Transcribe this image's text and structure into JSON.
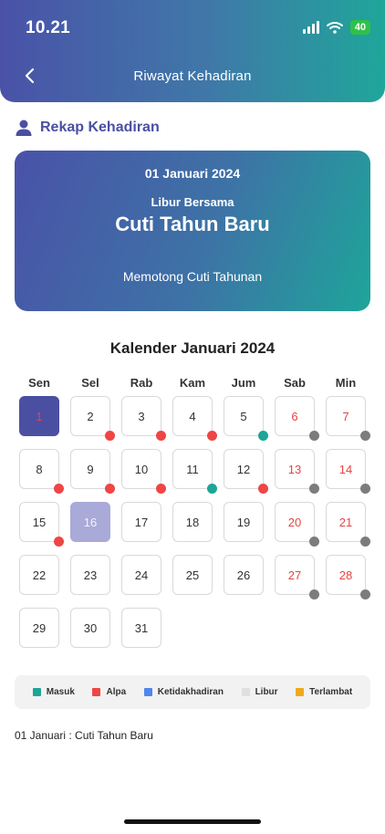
{
  "status_bar": {
    "time": "10.21",
    "battery": "40"
  },
  "header": {
    "title": "Riwayat Kehadiran"
  },
  "section": {
    "title": "Rekap Kehadiran"
  },
  "card": {
    "date": "01 Januari 2024",
    "type": "Libur Bersama",
    "name": "Cuti Tahun Baru",
    "note": "Memotong Cuti Tahunan"
  },
  "calendar": {
    "title": "Kalender Januari 2024",
    "weekdays": [
      "Sen",
      "Sel",
      "Rab",
      "Kam",
      "Jum",
      "Sab",
      "Min"
    ],
    "days": [
      {
        "day": "1",
        "style": "holiday",
        "status": ""
      },
      {
        "day": "2",
        "style": "",
        "status": "alpa"
      },
      {
        "day": "3",
        "style": "",
        "status": "alpa"
      },
      {
        "day": "4",
        "style": "",
        "status": "alpa"
      },
      {
        "day": "5",
        "style": "",
        "status": "masuk"
      },
      {
        "day": "6",
        "style": "weekend",
        "status": "libur"
      },
      {
        "day": "7",
        "style": "weekend",
        "status": "libur"
      },
      {
        "day": "8",
        "style": "",
        "status": "alpa"
      },
      {
        "day": "9",
        "style": "",
        "status": "alpa"
      },
      {
        "day": "10",
        "style": "",
        "status": "alpa"
      },
      {
        "day": "11",
        "style": "",
        "status": "masuk"
      },
      {
        "day": "12",
        "style": "",
        "status": "alpa"
      },
      {
        "day": "13",
        "style": "weekend",
        "status": "libur"
      },
      {
        "day": "14",
        "style": "weekend",
        "status": "libur"
      },
      {
        "day": "15",
        "style": "",
        "status": "alpa"
      },
      {
        "day": "16",
        "style": "today",
        "status": ""
      },
      {
        "day": "17",
        "style": "",
        "status": ""
      },
      {
        "day": "18",
        "style": "",
        "status": ""
      },
      {
        "day": "19",
        "style": "",
        "status": ""
      },
      {
        "day": "20",
        "style": "weekend",
        "status": "libur"
      },
      {
        "day": "21",
        "style": "weekend",
        "status": "libur"
      },
      {
        "day": "22",
        "style": "",
        "status": ""
      },
      {
        "day": "23",
        "style": "",
        "status": ""
      },
      {
        "day": "24",
        "style": "",
        "status": ""
      },
      {
        "day": "25",
        "style": "",
        "status": ""
      },
      {
        "day": "26",
        "style": "",
        "status": ""
      },
      {
        "day": "27",
        "style": "weekend",
        "status": "libur"
      },
      {
        "day": "28",
        "style": "weekend",
        "status": "libur"
      },
      {
        "day": "29",
        "style": "",
        "status": ""
      },
      {
        "day": "30",
        "style": "",
        "status": ""
      },
      {
        "day": "31",
        "style": "",
        "status": ""
      }
    ]
  },
  "legend": [
    {
      "label": "Masuk",
      "color": "#1ea596"
    },
    {
      "label": "Alpa",
      "color": "#ef4545"
    },
    {
      "label": "Ketidakhadiran",
      "color": "#4f86ef"
    },
    {
      "label": "Libur",
      "color": "#e0e0e0"
    },
    {
      "label": "Terlambat",
      "color": "#f0a91e"
    }
  ],
  "info": {
    "line": "01 Januari : Cuti Tahun Baru"
  }
}
